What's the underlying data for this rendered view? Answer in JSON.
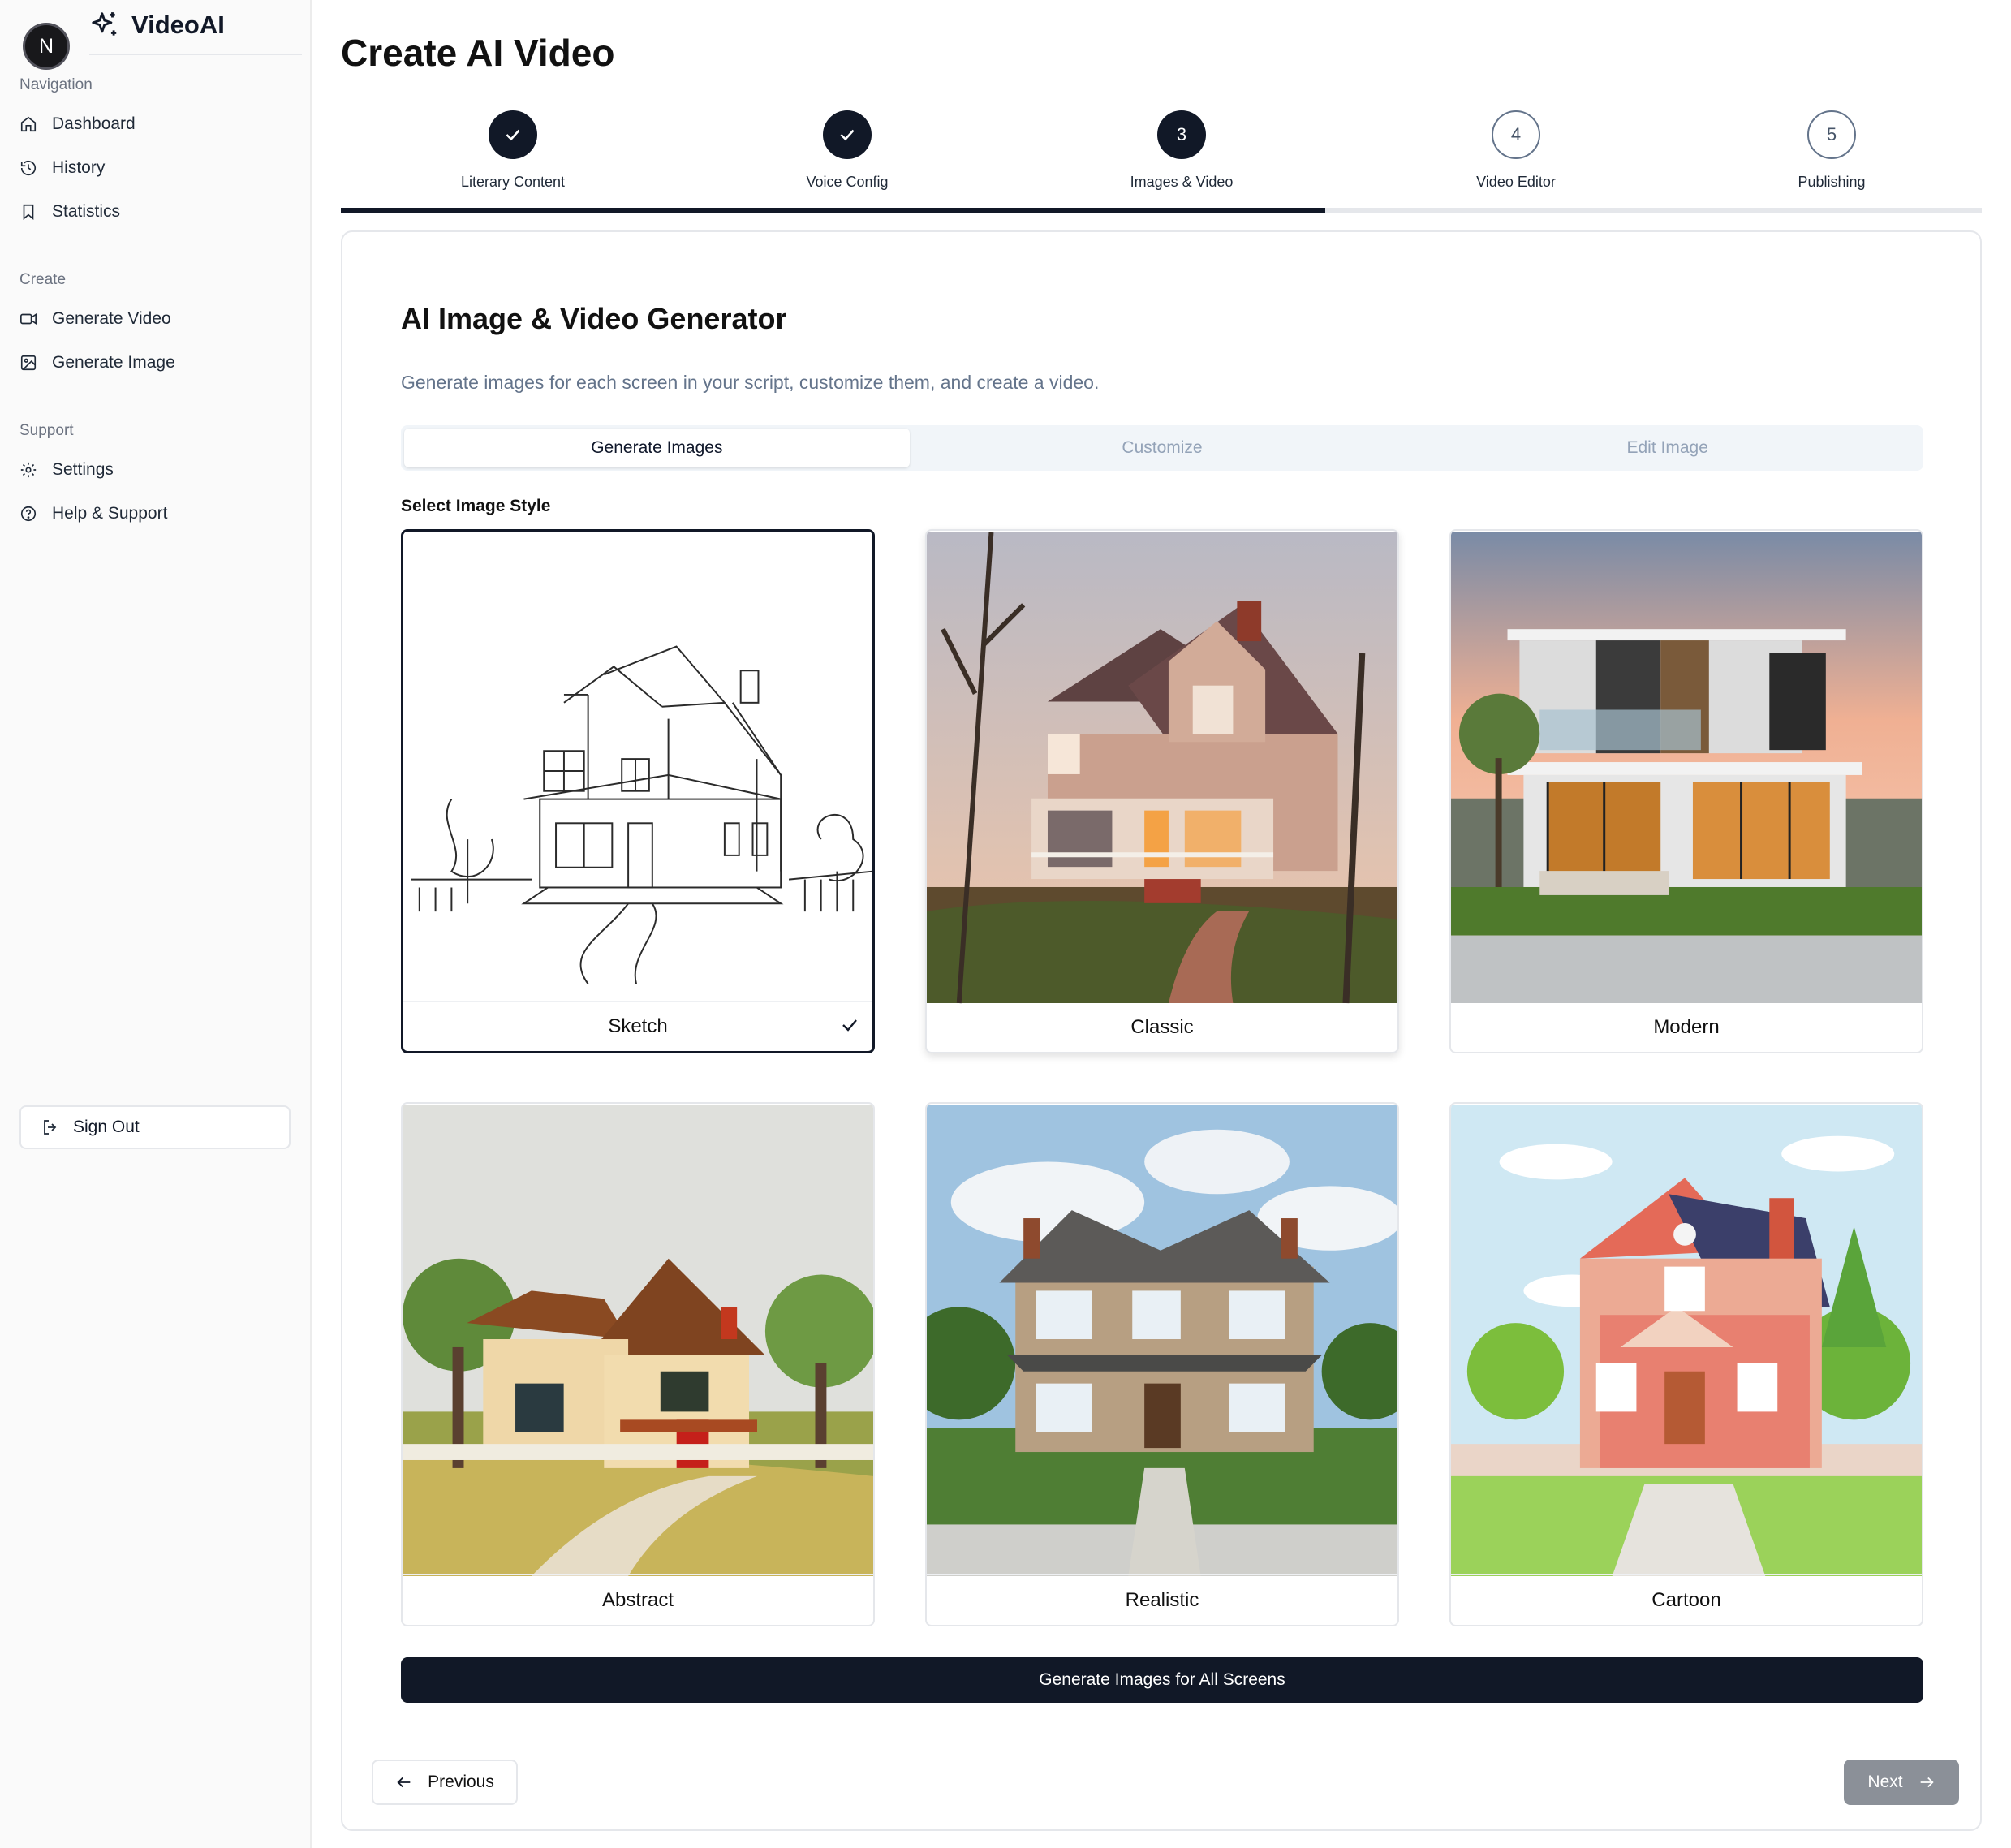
{
  "app": {
    "name": "VideoAI",
    "avatar_initial": "N"
  },
  "sidebar": {
    "sections": [
      {
        "title": "Navigation",
        "items": [
          {
            "label": "Dashboard",
            "icon": "home-icon"
          },
          {
            "label": "History",
            "icon": "history-icon"
          },
          {
            "label": "Statistics",
            "icon": "bookmark-icon"
          }
        ]
      },
      {
        "title": "Create",
        "items": [
          {
            "label": "Generate Video",
            "icon": "video-icon"
          },
          {
            "label": "Generate Image",
            "icon": "image-icon"
          }
        ]
      },
      {
        "title": "Support",
        "items": [
          {
            "label": "Settings",
            "icon": "gear-icon"
          },
          {
            "label": "Help & Support",
            "icon": "help-circle-icon"
          }
        ]
      }
    ],
    "sign_out_label": "Sign Out"
  },
  "page": {
    "title": "Create AI Video"
  },
  "stepper": {
    "steps": [
      {
        "number": "1",
        "label": "Literary Content",
        "state": "done"
      },
      {
        "number": "2",
        "label": "Voice Config",
        "state": "done"
      },
      {
        "number": "3",
        "label": "Images & Video",
        "state": "active"
      },
      {
        "number": "4",
        "label": "Video Editor",
        "state": "todo"
      },
      {
        "number": "5",
        "label": "Publishing",
        "state": "todo"
      }
    ],
    "progress_fraction": 0.6
  },
  "generator": {
    "title": "AI Image & Video Generator",
    "description": "Generate images for each screen in your script, customize them, and create a video.",
    "tabs": [
      {
        "label": "Generate Images",
        "active": true
      },
      {
        "label": "Customize",
        "active": false
      },
      {
        "label": "Edit Image",
        "active": false
      }
    ],
    "style_label": "Select Image Style",
    "styles": [
      {
        "name": "Sketch",
        "selected": true
      },
      {
        "name": "Classic",
        "selected": false
      },
      {
        "name": "Modern",
        "selected": false
      },
      {
        "name": "Abstract",
        "selected": false
      },
      {
        "name": "Realistic",
        "selected": false
      },
      {
        "name": "Cartoon",
        "selected": false
      }
    ],
    "generate_button": "Generate Images for All Screens"
  },
  "footer": {
    "previous_label": "Previous",
    "next_label": "Next"
  },
  "colors": {
    "primary": "#111827",
    "muted": "#64748b",
    "disabled_button": "#8b9098"
  }
}
